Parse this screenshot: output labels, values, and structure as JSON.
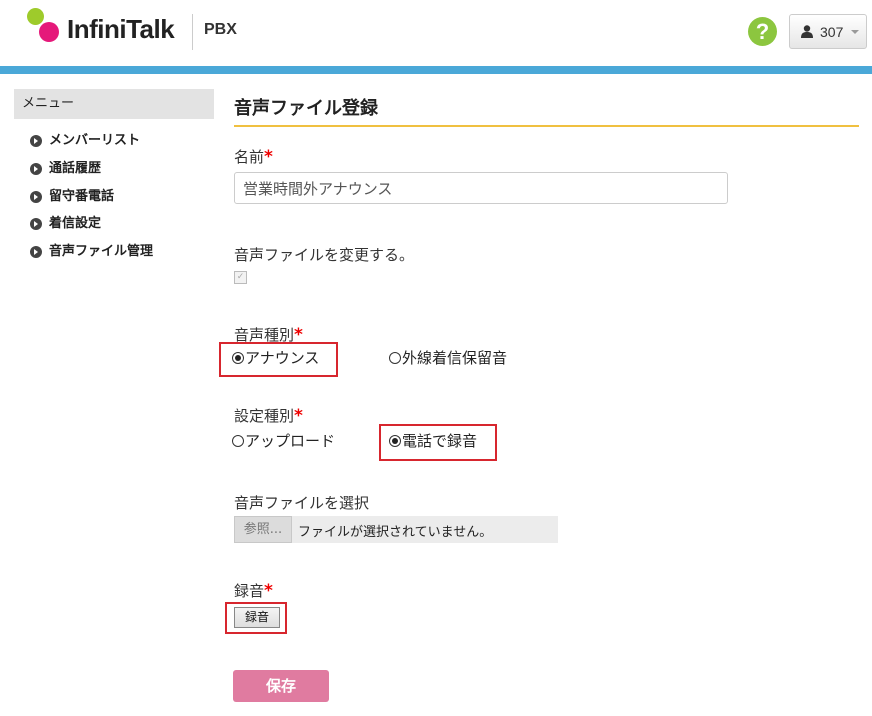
{
  "header": {
    "logo_text": "InfiniTalk",
    "app_name": "PBX",
    "help_icon_glyph": "?",
    "user_label": "307"
  },
  "sidebar": {
    "title": "メニュー",
    "items": [
      {
        "label": "メンバーリスト"
      },
      {
        "label": "通話履歴"
      },
      {
        "label": "留守番電話"
      },
      {
        "label": "着信設定"
      },
      {
        "label": "音声ファイル管理"
      }
    ]
  },
  "main": {
    "page_title": "音声ファイル登録",
    "name_label": "名前",
    "name_value": "営業時間外アナウンス",
    "change_file_label": "音声ファイルを変更する。",
    "change_file_checked": true,
    "voice_type_label": "音声種別",
    "voice_type_options": [
      {
        "label": "アナウンス",
        "selected": true
      },
      {
        "label": "外線着信保留音",
        "selected": false
      }
    ],
    "setting_type_label": "設定種別",
    "setting_type_options": [
      {
        "label": "アップロード",
        "selected": false
      },
      {
        "label": "電話で録音",
        "selected": true
      }
    ],
    "file_select_label": "音声ファイルを選択",
    "browse_label": "参照...",
    "file_status": "ファイルが選択されていません。",
    "record_label": "録音",
    "record_button": "録音",
    "save_button": "保存",
    "required_mark": "*"
  },
  "colors": {
    "accent_blue": "#4aa8d8",
    "title_rule": "#f0c040",
    "required": "#e00000",
    "highlight_box": "#d7262e",
    "save_button": "#e07ba0",
    "help_icon": "#8cc63f",
    "logo_green": "#9ecb2b",
    "logo_pink": "#e5197a"
  },
  "icons": {
    "help": "question-circle-icon",
    "user": "user-icon",
    "dropdown": "caret-down-icon",
    "nav": "chevron-circle-right-icon"
  }
}
